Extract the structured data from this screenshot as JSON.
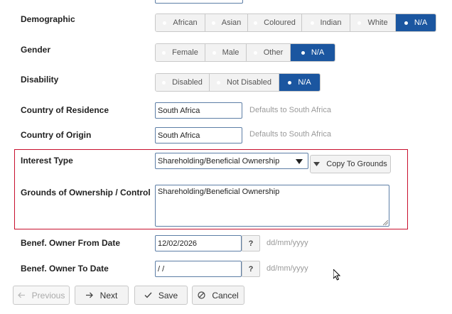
{
  "demographic": {
    "label": "Demographic",
    "options": [
      "African",
      "Asian",
      "Coloured",
      "Indian",
      "White",
      "N/A"
    ],
    "selected": "N/A"
  },
  "gender": {
    "label": "Gender",
    "options": [
      "Female",
      "Male",
      "Other",
      "N/A"
    ],
    "selected": "N/A"
  },
  "disability": {
    "label": "Disability",
    "options": [
      "Disabled",
      "Not Disabled",
      "N/A"
    ],
    "selected": "N/A"
  },
  "residence": {
    "label": "Country of Residence",
    "value": "South Africa",
    "hint": "Defaults to South Africa"
  },
  "origin": {
    "label": "Country of Origin",
    "value": "South Africa",
    "hint": "Defaults to South Africa"
  },
  "interest": {
    "label": "Interest Type",
    "selected": "Shareholding/Beneficial Ownership",
    "copy_button": "Copy To Grounds"
  },
  "grounds": {
    "label": "Grounds of Ownership / Control",
    "value": "Shareholding/Beneficial Ownership"
  },
  "from_date": {
    "label": "Benef. Owner From Date",
    "value": "12/02/2026",
    "help": "?",
    "hint": "dd/mm/yyyy"
  },
  "to_date": {
    "label": "Benef. Owner To Date",
    "value": "/ /",
    "help": "?",
    "hint": "dd/mm/yyyy"
  },
  "nav": {
    "previous": "Previous",
    "next": "Next",
    "save": "Save",
    "cancel": "Cancel"
  },
  "colors": {
    "selected": "#1b56a0",
    "highlight_border": "#c8102e",
    "input_border": "#5d7ea6"
  },
  "icons": {
    "previous": "arrow-left-icon",
    "next": "arrow-right-icon",
    "save": "check-icon",
    "cancel": "ban-icon",
    "copy": "triangle-down-icon",
    "cursor": "mouse-pointer-icon"
  }
}
